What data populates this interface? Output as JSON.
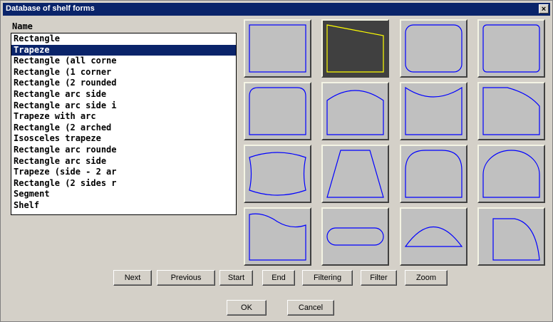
{
  "window": {
    "title": "Database of shelf forms",
    "close_glyph": "×"
  },
  "list": {
    "header": "Name",
    "items": [
      "Rectangle",
      "Trapeze",
      "Rectangle (all corne",
      "Rectangle (1 corner",
      "Rectangle (2 rounded",
      "Rectangle arc side",
      "Rectangle arc side i",
      "Trapeze with arc",
      "Rectangle (2 arched",
      "Isosceles trapeze",
      "Rectangle arc rounde",
      "Rectangle arc side",
      "Trapeze (side - 2 ar",
      "Rectangle (2 sides r",
      "Segment",
      "Shelf"
    ],
    "selected_index": 1
  },
  "shapes": {
    "selected_index": 1,
    "tiles": [
      "rectangle",
      "trapeze",
      "rounded-rectangle",
      "rounded-rectangle-small",
      "two-top-rounded",
      "arc-top",
      "arc-top-inward",
      "arc-top-right",
      "barrel",
      "isosceles-trapeze",
      "arched-top",
      "dome-top",
      "wave-top",
      "pill",
      "segment",
      "shelf-quarter"
    ]
  },
  "nav_buttons": [
    "Next",
    "Previous",
    "Start",
    "End",
    "Filtering",
    "Filter",
    "Zoom"
  ],
  "ok_label": "OK",
  "cancel_label": "Cancel",
  "colors": {
    "selection": "#0a246a",
    "shape_stroke": "#0000ff",
    "selected_shape_stroke": "#ffff00",
    "tile_bg": "#c0c0c0",
    "tile_selected_bg": "#404040"
  }
}
